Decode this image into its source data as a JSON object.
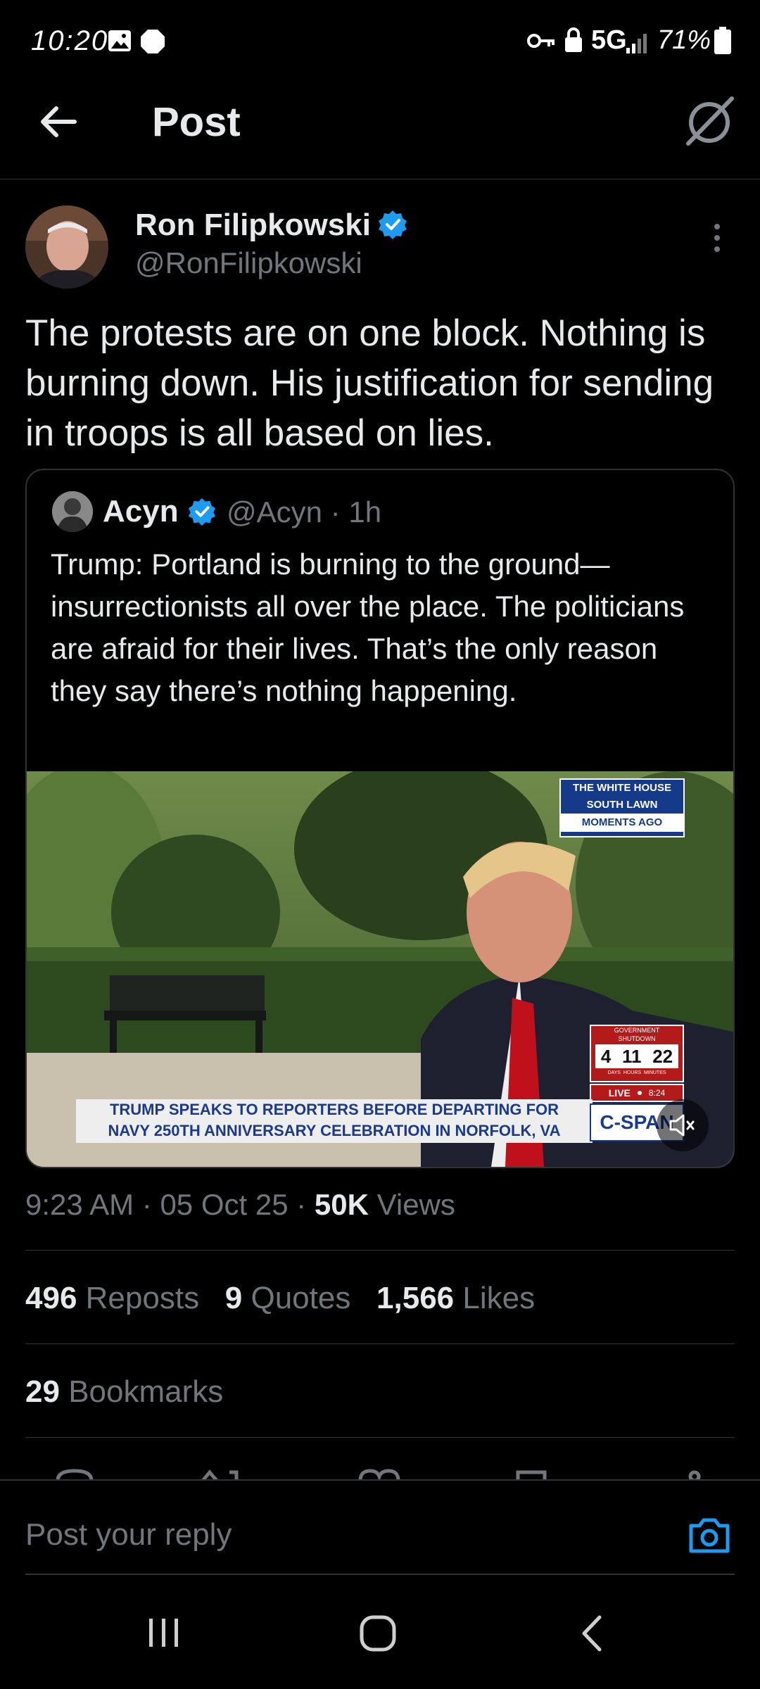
{
  "status_bar": {
    "time": "10:20",
    "network": "5G",
    "battery": "71%",
    "icons": [
      "gallery-icon",
      "notification-dot-icon",
      "vpn-key-icon",
      "lock-icon",
      "signal-icon",
      "battery-icon"
    ]
  },
  "header": {
    "title": "Post",
    "back_icon": "arrow-left-icon",
    "right_icon": "grok-icon"
  },
  "post": {
    "author_name": "Ron Filipkowski",
    "author_handle": "@RonFilipkowski",
    "verified": true,
    "text": "The protests are on one block. Nothing is burning down. His justification for sending in troops is all based on lies."
  },
  "quote": {
    "author_name": "Acyn",
    "author_handle": "@Acyn · 1h",
    "verified": true,
    "text": "Trump: Portland is burning to the ground—insurrectionists all over the place. The politicians are afraid for their lives. That’s the only reason they say there’s nothing happening."
  },
  "video": {
    "location_line1": "THE WHITE HOUSE",
    "location_line2": "SOUTH LAWN",
    "location_line3": "MOMENTS AGO",
    "shutdown_line1": "GOVERNMENT",
    "shutdown_line2": "SHUTDOWN",
    "shutdown_days": "4",
    "shutdown_hours": "11",
    "shutdown_minutes": "22",
    "shutdown_labels": "DAYS  HOURS  MINUTES",
    "live_label": "LIVE",
    "live_time": "8:24",
    "caption_line1": "TRUMP SPEAKS TO REPORTERS BEFORE DEPARTING FOR",
    "caption_line2": "NAVY 250TH ANNIVERSARY CELEBRATION IN NORFOLK, VA",
    "network_logo": "C-SPAN"
  },
  "meta": {
    "time": "9:23 AM",
    "date": "05 Oct 25",
    "views_count": "50K",
    "views_label": "Views"
  },
  "stats": {
    "reposts_count": "496",
    "reposts_label": "Reposts",
    "quotes_count": "9",
    "quotes_label": "Quotes",
    "likes_count": "1,566",
    "likes_label": "Likes",
    "bookmarks_count": "29",
    "bookmarks_label": "Bookmarks"
  },
  "reply": {
    "placeholder": "Post your reply"
  },
  "colors": {
    "background": "#000000",
    "text": "#e7e9ea",
    "muted": "#71767b",
    "accent": "#1d9bf0",
    "divider": "#2f3336"
  }
}
